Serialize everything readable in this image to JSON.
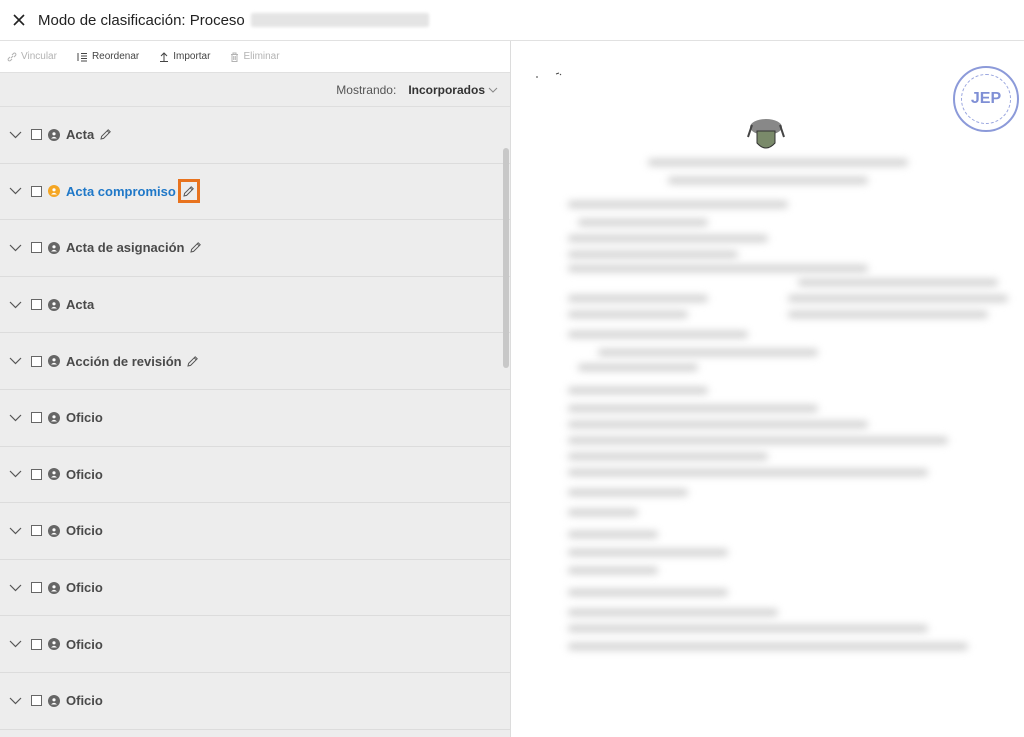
{
  "header": {
    "title": "Modo de clasificación: Proceso"
  },
  "toolbar": {
    "vincular": "Vincular",
    "reordenar": "Reordenar",
    "importar": "Importar",
    "eliminar": "Eliminar"
  },
  "filter": {
    "label": "Mostrando:",
    "value": "Incorporados"
  },
  "rows": [
    {
      "label": "Acta",
      "status": "gray",
      "edit": true,
      "active": false
    },
    {
      "label": "Acta compromiso",
      "status": "orange",
      "edit": true,
      "active": true
    },
    {
      "label": "Acta de asignación",
      "status": "gray",
      "edit": true,
      "active": false
    },
    {
      "label": "Acta",
      "status": "gray",
      "edit": false,
      "active": false
    },
    {
      "label": "Acción de revisión",
      "status": "gray",
      "edit": true,
      "active": false
    },
    {
      "label": "Oficio",
      "status": "gray",
      "edit": false,
      "active": false
    },
    {
      "label": "Oficio",
      "status": "gray",
      "edit": false,
      "active": false
    },
    {
      "label": "Oficio",
      "status": "gray",
      "edit": false,
      "active": false
    },
    {
      "label": "Oficio",
      "status": "gray",
      "edit": false,
      "active": false
    },
    {
      "label": "Oficio",
      "status": "gray",
      "edit": false,
      "active": false
    },
    {
      "label": "Oficio",
      "status": "gray",
      "edit": false,
      "active": false
    }
  ],
  "preview": {
    "seal_text": "JEP"
  },
  "colors": {
    "accent": "#1f78c8",
    "highlight": "#e8731e",
    "pending": "#f5a623"
  }
}
